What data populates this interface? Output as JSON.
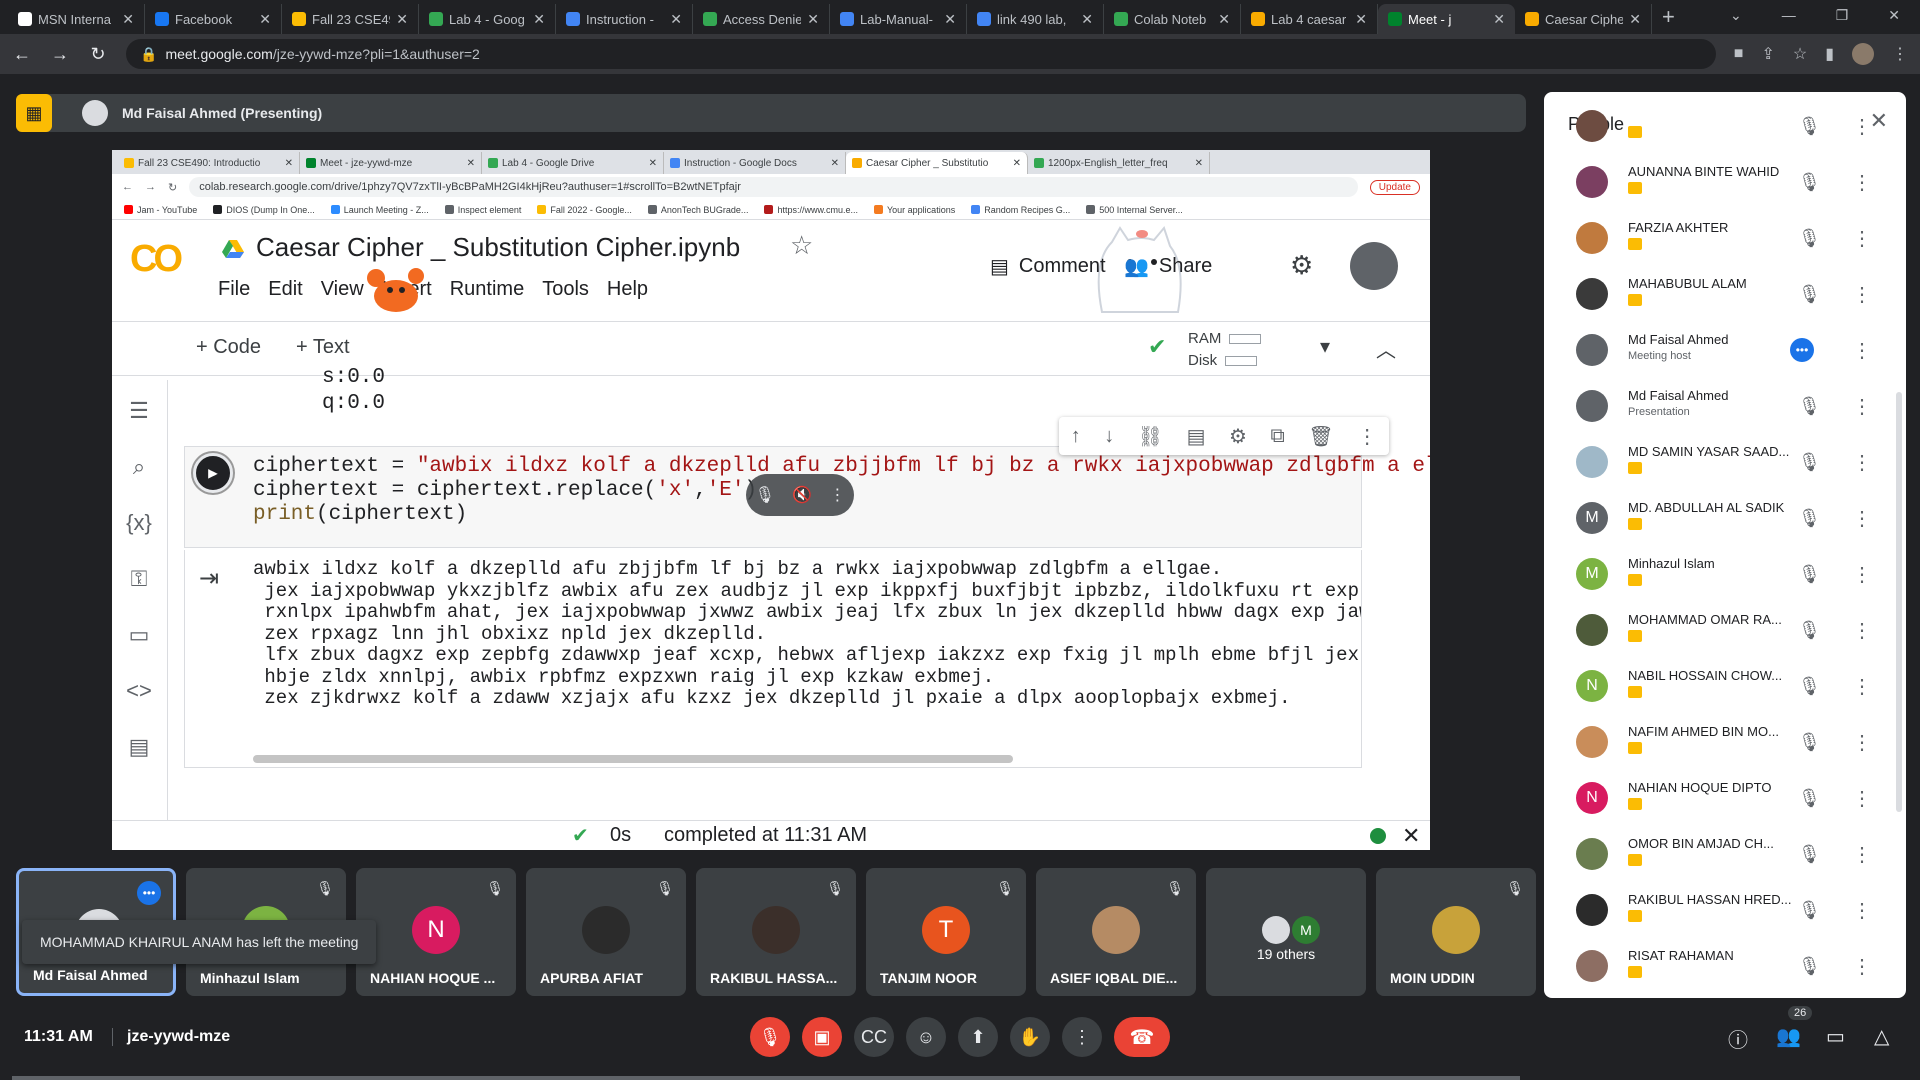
{
  "browser": {
    "tabs": [
      {
        "label": "MSN Interna",
        "color": "#ffffff"
      },
      {
        "label": "Facebook",
        "color": "#1877f2"
      },
      {
        "label": "Fall 23 CSE49",
        "color": "#fbbc04"
      },
      {
        "label": "Lab 4 - Goog",
        "color": "#34a853"
      },
      {
        "label": "Instruction -",
        "color": "#4285f4"
      },
      {
        "label": "Access Denie",
        "color": "#34a853"
      },
      {
        "label": "Lab-Manual-",
        "color": "#4285f4"
      },
      {
        "label": "link 490 lab,",
        "color": "#4285f4"
      },
      {
        "label": "Colab Noteb",
        "color": "#34a853"
      },
      {
        "label": "Lab 4 caesar",
        "color": "#f9ab00"
      },
      {
        "label": "Meet - j",
        "color": "#00832d",
        "active": true
      },
      {
        "label": "Caesar Ciphe",
        "color": "#f9ab00"
      }
    ],
    "url_host": "meet.google.com",
    "url_path": "/jze-yywd-mze?pli=1&authuser=2"
  },
  "presenting": {
    "label": "Md Faisal Ahmed (Presenting)"
  },
  "shared_screen": {
    "tabs": [
      {
        "label": "Fall 23 CSE490: Introductio",
        "color": "#fbbc04"
      },
      {
        "label": "Meet - jze-yywd-mze",
        "color": "#00832d"
      },
      {
        "label": "Lab 4 - Google Drive",
        "color": "#34a853"
      },
      {
        "label": "Instruction - Google Docs",
        "color": "#4285f4"
      },
      {
        "label": "Caesar Cipher _ Substitutio",
        "color": "#f9ab00",
        "active": true
      },
      {
        "label": "1200px-English_letter_freq",
        "color": "#34a853"
      }
    ],
    "url": "colab.research.google.com/drive/1phzy7QV7zxTlI-yBcBPaMH2GI4kHjReu?authuser=1#scrollTo=B2wtNETpfajr",
    "update_label": "Update",
    "bookmarks": [
      {
        "label": "Jam - YouTube",
        "color": "#ff0000"
      },
      {
        "label": "DIOS (Dump In One...",
        "color": "#202124"
      },
      {
        "label": "Launch Meeting - Z...",
        "color": "#2d8cff"
      },
      {
        "label": "Inspect element",
        "color": "#5f6368"
      },
      {
        "label": "Fall 2022 - Google...",
        "color": "#fbbc04"
      },
      {
        "label": "AnonTech BUGrade...",
        "color": "#5f6368"
      },
      {
        "label": "https://www.cmu.e...",
        "color": "#b31b1b"
      },
      {
        "label": "Your applications",
        "color": "#f47b20"
      },
      {
        "label": "Random Recipes G...",
        "color": "#4285f4"
      },
      {
        "label": "500 Internal Server...",
        "color": "#5f6368"
      }
    ],
    "colab": {
      "logo": "CO",
      "title": "Caesar Cipher _ Substitution Cipher.ipynb",
      "menu": [
        "File",
        "Edit",
        "View",
        "Insert",
        "Runtime",
        "Tools",
        "Help"
      ],
      "comment": "Comment",
      "share": "Share",
      "add_code": "+ Code",
      "add_text": "+ Text",
      "ram": "RAM",
      "disk": "Disk",
      "prev_output": [
        "s:0.0",
        "q:0.0"
      ],
      "code": {
        "l1_a": "ciphertext = ",
        "l1_b": "\"awbix ildxz kolf a dkzeplld afu zbjjbfm lf bj bz a rwkx iajxpobwwap zdlgbfm a ellga",
        "l2_a": "ciphertext = ciphertext.replace(",
        "l2_b": "'x'",
        "l2_c": ",",
        "l2_d": "'E'",
        "l2_e": ")",
        "l3_a": "print",
        "l3_b": "(ciphertext)"
      },
      "output": [
        "awbix ildxz kolf a dkzeplld afu zbjjbfm lf bj bz a rwkx iajxpobwwap zdlgbfm a ellgae.",
        " jex iajxpobwwap ykxzjblfz awbix afu zex audbjz jl exp ikppxfj buxfjbjt ipbzbz, ildolkfuxu rt exp l",
        " rxnlpx ipahwbfm ahat, jex iajxpobwwap jxwwz awbix jeaj lfx zbux ln jex dkzeplld hbww dagx exp jaw",
        " zex rpxagz lnn jhl obxixz npld jex dkzeplld.",
        " lfx zbux dagxz exp zepbfg zdawwxp jeaf xcxp, hebwx afljexp iakzxz exp fxig jl mplh ebme bfjl jex",
        " hbje zldx xnnlpj, awbix rpbfmz expzxwn raig jl exp kzkaw exbmej.",
        " zex zjkdrwxz kolf a zdaww xzjajx afu kzxz jex dkzeplld jl pxaie a dlpx aooplopbajx exbmej."
      ],
      "status_time": "0s",
      "status_text": "completed at 11:31 AM"
    }
  },
  "people": {
    "title": "People",
    "list": [
      {
        "name": "",
        "sub": "",
        "avatar": "#6d4c41",
        "letter": "",
        "host": false
      },
      {
        "name": "AUNANNA BINTE WAHID",
        "avatar": "#7b3f61",
        "letter": ""
      },
      {
        "name": "FARZIA AKHTER",
        "avatar": "#c07a3e",
        "letter": ""
      },
      {
        "name": "MAHABUBUL ALAM",
        "avatar": "#3a3a3a",
        "letter": ""
      },
      {
        "name": "Md Faisal Ahmed",
        "sub": "Meeting host",
        "avatar": "#5f6368",
        "letter": "",
        "host": true
      },
      {
        "name": "Md Faisal Ahmed",
        "sub": "Presentation",
        "avatar": "#5f6368",
        "letter": ""
      },
      {
        "name": "MD SAMIN YASAR SAAD...",
        "avatar": "#9fb8c8",
        "letter": ""
      },
      {
        "name": "MD. ABDULLAH AL SADIK",
        "avatar": "#5f6368",
        "letter": "M"
      },
      {
        "name": "Minhazul Islam",
        "avatar": "#7cb342",
        "letter": "M"
      },
      {
        "name": "MOHAMMAD OMAR RA...",
        "avatar": "#4e5b3a",
        "letter": ""
      },
      {
        "name": "NABIL HOSSAIN CHOW...",
        "avatar": "#7cb342",
        "letter": "N"
      },
      {
        "name": "NAFIM AHMED BIN MO...",
        "avatar": "#c98d5a",
        "letter": ""
      },
      {
        "name": "NAHIAN HOQUE DIPTO",
        "avatar": "#d81b60",
        "letter": "N"
      },
      {
        "name": "OMOR BIN AMJAD CH...",
        "avatar": "#6a7d4f",
        "letter": ""
      },
      {
        "name": "RAKIBUL HASSAN HRED...",
        "avatar": "#2b2b2b",
        "letter": ""
      },
      {
        "name": "RISAT RAHAMAN",
        "avatar": "#8d6e63",
        "letter": ""
      }
    ]
  },
  "tiles": [
    {
      "name": "Md Faisal Ahmed",
      "avatar": "#dadce0",
      "letter": ""
    },
    {
      "name": "Minhazul Islam",
      "avatar": "#7cb342",
      "letter": "M"
    },
    {
      "name": "NAHIAN HOQUE ...",
      "avatar": "#d81b60",
      "letter": "N"
    },
    {
      "name": "APURBA AFIAT",
      "avatar": "#2b2b2b",
      "letter": ""
    },
    {
      "name": "RAKIBUL HASSA...",
      "avatar": "#3b2f2a",
      "letter": ""
    },
    {
      "name": "TANJIM NOOR",
      "avatar": "#e8541e",
      "letter": "T"
    },
    {
      "name": "ASIEF IQBAL DIE...",
      "avatar": "#b58b64",
      "letter": ""
    },
    {
      "name": "19 others",
      "avatar": "#dadce0",
      "letter": ""
    },
    {
      "name": "MOIN UDDIN",
      "avatar": "#c8a23a",
      "letter": ""
    }
  ],
  "others_letter": "M",
  "toast": "MOHAMMAD KHAIRUL ANAM has left the meeting",
  "meeting": {
    "time": "11:31 AM",
    "code": "jze-yywd-mze",
    "participants": "26"
  }
}
